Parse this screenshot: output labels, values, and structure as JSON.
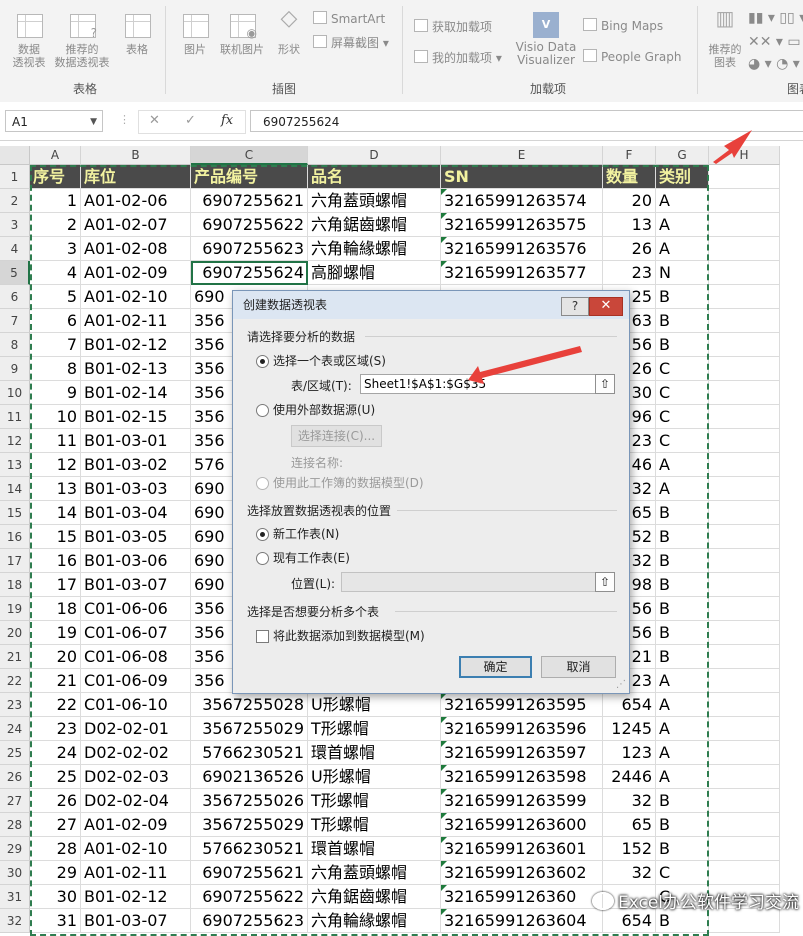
{
  "ribbon": {
    "groups": [
      {
        "label": "表格",
        "buttons": [
          {
            "label": "数据\n透视表",
            "icon": "pivot-table-icon"
          },
          {
            "label": "推荐的\n数据透视表",
            "icon": "recommended-pivot-icon"
          },
          {
            "label": "表格",
            "icon": "table-icon"
          }
        ]
      },
      {
        "label": "插图",
        "buttons": [
          {
            "label": "图片",
            "icon": "picture-icon"
          },
          {
            "label": "联机图片",
            "icon": "online-picture-icon"
          },
          {
            "label": "形状",
            "icon": "shapes-icon"
          }
        ],
        "small": [
          "SmartArt",
          "屏幕截图"
        ]
      },
      {
        "label": "加载项",
        "small": [
          "获取加载项",
          "我的加载项"
        ],
        "visio": "Visio Data\nVisualizer",
        "right": [
          "Bing Maps",
          "People Graph"
        ]
      },
      {
        "label": "图表",
        "buttons": [
          {
            "label": "推荐的\n图表",
            "icon": "recommended-chart-icon"
          }
        ]
      }
    ]
  },
  "formula_bar": {
    "name_box": "A1",
    "fx": "fx",
    "value": "6907255624"
  },
  "columns": [
    "A",
    "B",
    "C",
    "D",
    "E",
    "F",
    "G",
    "H"
  ],
  "table": {
    "header": [
      "序号",
      "库位",
      "产品编号",
      "品名",
      "SN",
      "数量",
      "类别"
    ],
    "rows": [
      [
        "1",
        "A01-02-06",
        "6907255621",
        "六角蓋頭螺帽",
        "32165991263574",
        "20",
        "A"
      ],
      [
        "2",
        "A01-02-07",
        "6907255622",
        "六角鋸齒螺帽",
        "32165991263575",
        "13",
        "A"
      ],
      [
        "3",
        "A01-02-08",
        "6907255623",
        "六角輪緣螺帽",
        "32165991263576",
        "26",
        "A"
      ],
      [
        "4",
        "A01-02-09",
        "6907255624",
        "高腳螺帽",
        "32165991263577",
        "23",
        "N"
      ],
      [
        "5",
        "A01-02-10",
        "690",
        "",
        "",
        "25",
        "B"
      ],
      [
        "6",
        "A01-02-11",
        "356",
        "",
        "",
        "63",
        "B"
      ],
      [
        "7",
        "B01-02-12",
        "356",
        "",
        "",
        "256",
        "B"
      ],
      [
        "8",
        "B01-02-13",
        "356",
        "",
        "",
        "26",
        "C"
      ],
      [
        "9",
        "B01-02-14",
        "356",
        "",
        "",
        "30",
        "C"
      ],
      [
        "10",
        "B01-02-15",
        "356",
        "",
        "",
        "96",
        "C"
      ],
      [
        "11",
        "B01-03-01",
        "356",
        "",
        "",
        "23",
        "C"
      ],
      [
        "12",
        "B01-03-02",
        "576",
        "",
        "",
        "46",
        "A"
      ],
      [
        "13",
        "B01-03-03",
        "690",
        "",
        "",
        "32",
        "A"
      ],
      [
        "14",
        "B01-03-04",
        "690",
        "",
        "",
        "65",
        "B"
      ],
      [
        "15",
        "B01-03-05",
        "690",
        "",
        "",
        "52",
        "B"
      ],
      [
        "16",
        "B01-03-06",
        "690",
        "",
        "",
        "32",
        "B"
      ],
      [
        "17",
        "B01-03-07",
        "690",
        "",
        "",
        "98",
        "B"
      ],
      [
        "18",
        "C01-06-06",
        "356",
        "",
        "",
        "56",
        "B"
      ],
      [
        "19",
        "C01-06-07",
        "356",
        "",
        "",
        "56",
        "B"
      ],
      [
        "20",
        "C01-06-08",
        "356",
        "",
        "",
        "21",
        "B"
      ],
      [
        "21",
        "C01-06-09",
        "356",
        "",
        "",
        "23",
        "A"
      ],
      [
        "22",
        "C01-06-10",
        "3567255028",
        "U形螺帽",
        "32165991263595",
        "654",
        "A"
      ],
      [
        "23",
        "D02-02-01",
        "3567255029",
        "T形螺帽",
        "32165991263596",
        "1245",
        "A"
      ],
      [
        "24",
        "D02-02-02",
        "5766230521",
        "環首螺帽",
        "32165991263597",
        "123",
        "A"
      ],
      [
        "25",
        "D02-02-03",
        "6902136526",
        "U形螺帽",
        "32165991263598",
        "2446",
        "A"
      ],
      [
        "26",
        "D02-02-04",
        "3567255026",
        "T形螺帽",
        "32165991263599",
        "32",
        "B"
      ],
      [
        "27",
        "A01-02-09",
        "3567255029",
        "T形螺帽",
        "32165991263600",
        "65",
        "B"
      ],
      [
        "28",
        "A01-02-10",
        "5766230521",
        "環首螺帽",
        "32165991263601",
        "152",
        "B"
      ],
      [
        "29",
        "A01-02-11",
        "6907255621",
        "六角蓋頭螺帽",
        "32165991263602",
        "32",
        "C"
      ],
      [
        "30",
        "B01-02-12",
        "6907255622",
        "六角鋸齒螺帽",
        "3216599126360",
        "",
        "C"
      ],
      [
        "31",
        "B01-03-07",
        "6907255623",
        "六角輪緣螺帽",
        "32165991263604",
        "654",
        "B"
      ]
    ]
  },
  "dialog": {
    "title": "创建数据透视表",
    "help": "?",
    "close": "✕",
    "section1": "请选择要分析的数据",
    "opt_range": "选择一个表或区域(S)",
    "range_label": "表/区域(T):",
    "range_value": "Sheet1!$A$1:$G$35",
    "opt_external": "使用外部数据源(U)",
    "choose_conn": "选择连接(C)...",
    "conn_name": "连接名称:",
    "opt_model": "使用此工作簿的数据模型(D)",
    "section2": "选择放置数据透视表的位置",
    "opt_new": "新工作表(N)",
    "opt_existing": "现有工作表(E)",
    "location_label": "位置(L):",
    "location_value": "",
    "section3": "选择是否想要分析多个表",
    "add_model": "将此数据添加到数据模型(M)",
    "ok": "确定",
    "cancel": "取消"
  },
  "watermark": "Excel办公软件学习交流",
  "colors": {
    "header_bg": "#4a4a4a",
    "header_fg": "#f2f2a0",
    "accent": "#217346",
    "arrow": "#e8413b"
  }
}
